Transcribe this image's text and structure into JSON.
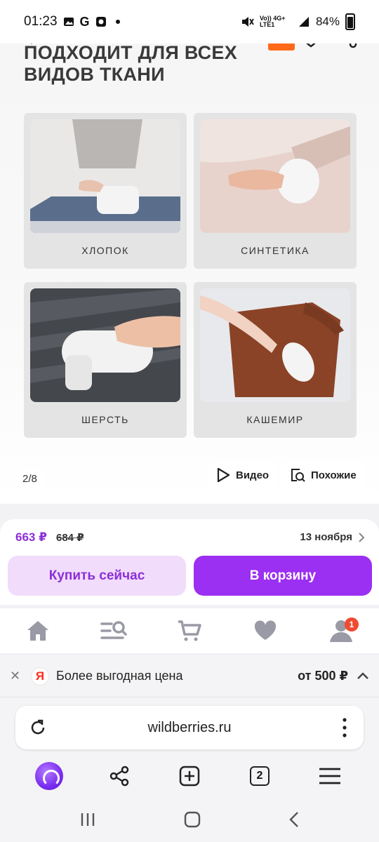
{
  "status_bar": {
    "time": "01:23",
    "g_label": "G",
    "network_label": "Vo)) 4G+ LTE1",
    "battery": "84%"
  },
  "gallery": {
    "title": "ПОДХОДИТ ДЛЯ ВСЕХ ВИДОВ ТКАНИ",
    "fabrics": [
      {
        "label": "ХЛОПОК",
        "icon": "cotton-photo"
      },
      {
        "label": "СИНТЕТИКА",
        "icon": "synthetic-photo"
      },
      {
        "label": "ШЕРСТЬ",
        "icon": "wool-photo"
      },
      {
        "label": "КАШЕМИР",
        "icon": "cashmere-photo"
      }
    ],
    "counter": "2/8",
    "video_label": "Видео",
    "similar_label": "Похожие"
  },
  "purchase": {
    "price_now": "663 ₽",
    "price_old": "684 ₽",
    "delivery_date": "13 ноября",
    "buy_now_label": "Купить сейчас",
    "cart_label": "В корзину",
    "accent_color": "#9b2ff2"
  },
  "bottom_nav": {
    "items": [
      "home-icon",
      "catalog-search-icon",
      "cart-icon",
      "favorites-icon",
      "profile-icon"
    ],
    "profile_badge": "1"
  },
  "yandex_banner": {
    "logo": "Я",
    "text": "Более выгодная цена",
    "price": "от 500 ₽"
  },
  "browser": {
    "url": "wildberries.ru",
    "tabs_count": "2"
  }
}
